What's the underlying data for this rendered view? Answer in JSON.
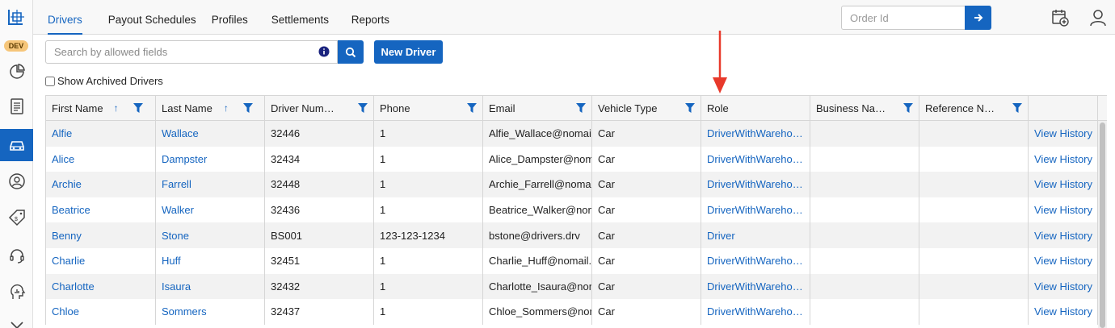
{
  "rail": {
    "badge": "DEV",
    "icons": [
      "logo-icon",
      "pie-chart-icon",
      "document-icon",
      "car-icon",
      "user-circle-icon",
      "price-tag-icon",
      "headset-icon",
      "analytics-icon",
      "tools-icon"
    ]
  },
  "nav": {
    "tabs": [
      {
        "label": "Drivers",
        "active": true
      },
      {
        "label": "Payout Schedules"
      },
      {
        "label": "Profiles"
      },
      {
        "label": "Settlements"
      },
      {
        "label": "Reports"
      }
    ],
    "order_placeholder": "Order Id"
  },
  "toolbar": {
    "search_placeholder": "Search by allowed fields",
    "new_driver_label": "New Driver",
    "archived_label": "Show Archived Drivers"
  },
  "grid": {
    "columns": [
      "First Name",
      "Last Name",
      "Driver Num…",
      "Phone",
      "Email",
      "Vehicle Type",
      "Role",
      "Business Na…",
      "Reference N…",
      ""
    ],
    "rows": [
      [
        "Alfie",
        "Wallace",
        "32446",
        "1",
        "Alfie_Wallace@nomail.a",
        "Car",
        "DriverWithWareho…",
        "",
        "",
        "View History"
      ],
      [
        "Alice",
        "Dampster",
        "32434",
        "1",
        "Alice_Dampster@noma",
        "Car",
        "DriverWithWareho…",
        "",
        "",
        "View History"
      ],
      [
        "Archie",
        "Farrell",
        "32448",
        "1",
        "Archie_Farrell@nomail.",
        "Car",
        "DriverWithWareho…",
        "",
        "",
        "View History"
      ],
      [
        "Beatrice",
        "Walker",
        "32436",
        "1",
        "Beatrice_Walker@noma",
        "Car",
        "DriverWithWareho…",
        "",
        "",
        "View History"
      ],
      [
        "Benny",
        "Stone",
        "BS001",
        "123-123-1234",
        "bstone@drivers.drv",
        "Car",
        "Driver",
        "",
        "",
        "View History"
      ],
      [
        "Charlie",
        "Huff",
        "32451",
        "1",
        "Charlie_Huff@nomail.a",
        "Car",
        "DriverWithWareho…",
        "",
        "",
        "View History"
      ],
      [
        "Charlotte",
        "Isaura",
        "32432",
        "1",
        "Charlotte_Isaura@nom",
        "Car",
        "DriverWithWareho…",
        "",
        "",
        "View History"
      ],
      [
        "Chloe",
        "Sommers",
        "32437",
        "1",
        "Chloe_Sommers@noma",
        "Car",
        "DriverWithWareho…",
        "",
        "",
        "View History"
      ]
    ]
  },
  "colors": {
    "accent": "#1565c0",
    "annotation": "#e8392b"
  }
}
